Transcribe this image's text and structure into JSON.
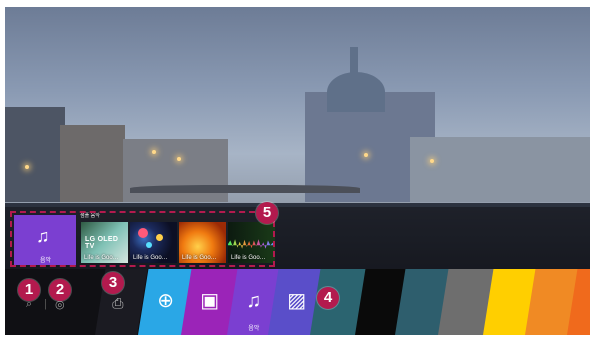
{
  "recent": {
    "group_label": "샘플 음악",
    "music_tile_label": "음악",
    "thumbnails": [
      {
        "caption": "Life is Goo…",
        "logo": "LG OLED TV"
      },
      {
        "caption": "Life is Goo…"
      },
      {
        "caption": "Life is Goo…"
      },
      {
        "caption": "Life is Goo…"
      }
    ]
  },
  "launcher": {
    "music_label": "음악",
    "app_cards": [
      {
        "color": "#2aa7e6",
        "icon": "globe-icon"
      },
      {
        "color": "#9b24b8",
        "icon": "photo-icon"
      },
      {
        "color": "#7b3fd1",
        "icon": "music-note-icon"
      },
      {
        "color": "#5a4ec9",
        "icon": "photo-video-icon"
      },
      {
        "color": "#2b6470",
        "icon": ""
      },
      {
        "color": "#0a0a0a",
        "icon": ""
      },
      {
        "color": "#2e5e6d",
        "icon": ""
      },
      {
        "color": "#6e6e6e",
        "icon": ""
      },
      {
        "color": "#ffcf00",
        "icon": ""
      },
      {
        "color": "#f08a24",
        "icon": ""
      },
      {
        "color": "#f06a1c",
        "icon": ""
      }
    ]
  },
  "badges": [
    "1",
    "2",
    "3",
    "4",
    "5"
  ],
  "icons": {
    "search": "search-icon",
    "settings": "settings-icon",
    "input": "input-source-icon"
  }
}
